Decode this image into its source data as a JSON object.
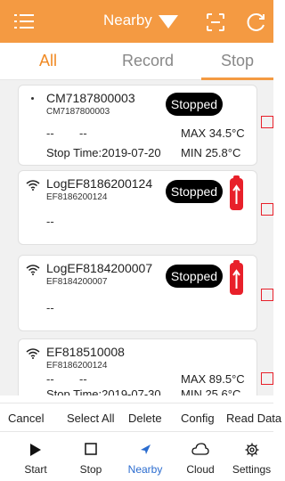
{
  "header": {
    "title": "Nearby",
    "accent": "#f49a42"
  },
  "tabs": [
    {
      "label": "All",
      "active": true
    },
    {
      "label": "Record",
      "active": false
    },
    {
      "label": "Stop",
      "active": false
    }
  ],
  "devices": [
    {
      "name": "CM7187800003",
      "id": "CM7187800003",
      "status": "Stopped",
      "line1": "--",
      "line2": "--",
      "max": "MAX  34.5°C",
      "min": "MIN  25.8°C",
      "stop_time": "Stop Time:2019-07-20",
      "icon": "dot-icon"
    },
    {
      "name": "LogEF8186200124",
      "id": "EF8186200124",
      "status": "Stopped",
      "line1": "--",
      "icon": "wifi-icon",
      "battery": "battery-low-icon"
    },
    {
      "name": "LogEF8184200007",
      "id": "EF8184200007",
      "status": "Stopped",
      "line1": "--",
      "icon": "wifi-icon",
      "battery": "battery-low-icon"
    },
    {
      "name": "EF818510008",
      "id": "EF8186200124",
      "line1": "--",
      "line2": "--",
      "max": "MAX  89.5°C",
      "min": "MIN  25.6°C",
      "stop_time": "Stop Time:2019-07-30",
      "icon": "wifi-icon"
    }
  ],
  "actions": [
    "Cancel",
    "Select All",
    "Delete",
    "Config",
    "Read Data"
  ],
  "nav": [
    {
      "label": "Start",
      "icon": "play-icon",
      "active": false
    },
    {
      "label": "Stop",
      "icon": "stop-icon",
      "active": false
    },
    {
      "label": "Nearby",
      "icon": "compass-icon",
      "active": true
    },
    {
      "label": "Cloud",
      "icon": "cloud-icon",
      "active": false
    },
    {
      "label": "Settings",
      "icon": "gear-icon",
      "active": false
    }
  ]
}
